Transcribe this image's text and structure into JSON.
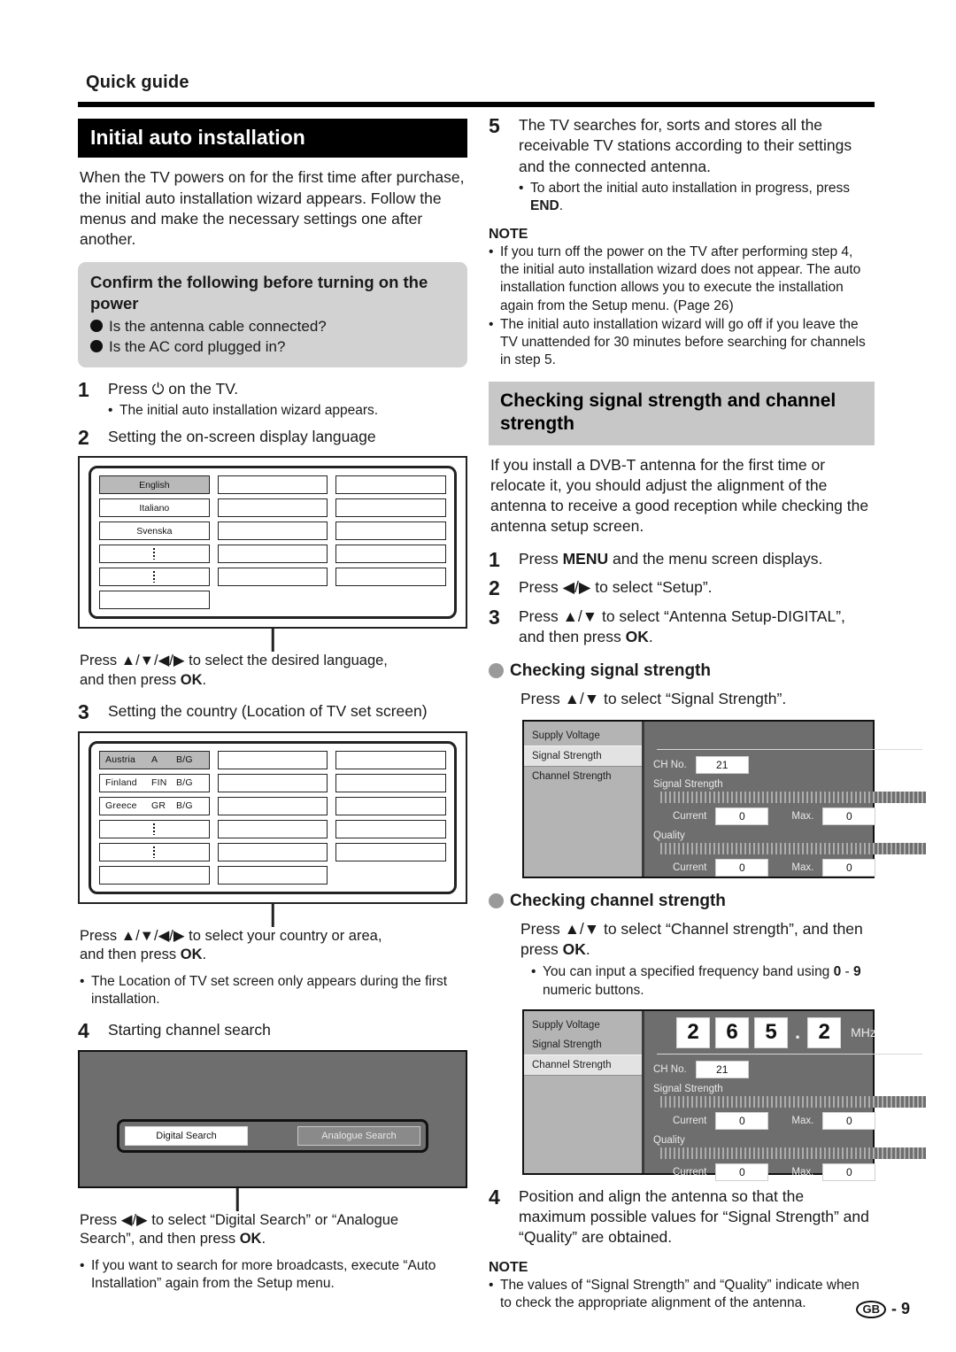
{
  "header": {
    "kicker": "Quick guide"
  },
  "left": {
    "section_title": "Initial auto installation",
    "intro": "When the TV powers on for the first time after purchase, the initial auto installation wizard appears. Follow the menus and make the necessary settings one after another.",
    "callout": {
      "heading": "Confirm the following  before turning on the power",
      "items": [
        "Is the antenna cable connected?",
        "Is the AC cord plugged in?"
      ]
    },
    "steps": [
      {
        "num": "1",
        "text": "Press ⏻ on the TV.",
        "bullets": [
          "The initial auto installation wizard appears."
        ]
      },
      {
        "num": "2",
        "text": "Setting the on-screen display language",
        "bullets": []
      },
      {
        "num": "3",
        "text": "Setting the country (Location of TV set screen)",
        "bullets": []
      },
      {
        "num": "4",
        "text": "Starting channel search",
        "bullets": []
      }
    ],
    "language_screen": {
      "col1": [
        "English",
        "Italiano",
        "Svenska",
        "",
        "",
        ""
      ],
      "col2": [
        "",
        "",
        "",
        "",
        "",
        ""
      ],
      "col3": [
        "",
        "",
        "",
        "",
        ""
      ],
      "selected": "English"
    },
    "language_caption_1": "Press ▲/▼/◀/▶ to select the desired language,",
    "language_caption_2": "and then press ",
    "language_caption_ok": "OK",
    "language_caption_end": ".",
    "country_screen": {
      "rows": [
        {
          "name": "Austria",
          "code": "A",
          "sys": "B/G",
          "selected": true
        },
        {
          "name": "Finland",
          "code": "FIN",
          "sys": "B/G",
          "selected": false
        },
        {
          "name": "Greece",
          "code": "GR",
          "sys": "B/G",
          "selected": false
        }
      ]
    },
    "country_caption_1": "Press ▲/▼/◀/▶ to select your country or area,",
    "country_caption_2": "and then press ",
    "country_caption_ok": "OK",
    "country_caption_end": ".",
    "country_bullet": "The Location of TV set screen only appears during the first installation.",
    "search_screen": {
      "digital_label": "Digital Search",
      "analogue_label": "Analogue Search"
    },
    "search_caption_1": "Press ◀/▶ to select “Digital Search” or “Analogue",
    "search_caption_2": "Search”, and then press ",
    "search_caption_ok": "OK",
    "search_caption_end": ".",
    "search_bullet": "If you want to search for more broadcasts, execute “Auto Installation” again from the Setup menu."
  },
  "right": {
    "step5": {
      "num": "5",
      "text": "The TV searches for, sorts and stores all the receivable TV stations according to their settings and the connected antenna.",
      "bullet_pre": "To abort the initial auto installation in progress, press ",
      "bullet_bold": "END",
      "bullet_post": "."
    },
    "note1_heading": "NOTE",
    "note1_items": [
      "If you turn off the power on the TV after performing step 4, the initial auto installation wizard does not appear. The auto installation function allows you to execute the installation again from the Setup menu. (Page 26)",
      "The initial auto installation wizard will go off if you leave the TV unattended for 30 minutes before searching for channels in step 5."
    ],
    "section_title": "Checking signal strength and channel strength",
    "intro": "If you install a DVB-T antenna for the first time or relocate it, you should adjust the alignment of the antenna to receive a good reception while checking the antenna setup screen.",
    "steps": [
      {
        "num": "1",
        "pre": "Press ",
        "bold": "MENU",
        "post": " and the menu screen displays."
      },
      {
        "num": "2",
        "pre": "Press ◀/▶ to select “Setup”.",
        "bold": "",
        "post": ""
      },
      {
        "num": "3",
        "pre": "Press ▲/▼ to select “Antenna Setup-DIGITAL”, and then press ",
        "bold": "OK",
        "post": "."
      }
    ],
    "signal_subhead": "Checking signal strength",
    "signal_instruction": "Press ▲/▼ to select “Signal Strength”.",
    "channel_subhead": "Checking channel strength",
    "channel_instruction_pre": "Press ▲/▼ to select “Channel strength”, and then press ",
    "channel_instruction_bold": "OK",
    "channel_instruction_post": ".",
    "channel_bullet_pre": "You can input a specified frequency band using ",
    "channel_bullet_bold1": "0",
    "channel_bullet_mid": " - ",
    "channel_bullet_bold2": "9",
    "channel_bullet_post": " numeric buttons.",
    "step4": {
      "num": "4",
      "text": "Position and align the antenna so that the maximum possible values for “Signal Strength” and “Quality” are obtained."
    },
    "note2_heading": "NOTE",
    "note2_items": [
      "The values of “Signal Strength” and “Quality” indicate when to check the appropriate alignment of the antenna."
    ],
    "osd": {
      "menu_items": [
        "Supply Voltage",
        "Signal Strength",
        "Channel Strength"
      ],
      "signal_active": "Signal Strength",
      "channel_active": "Channel Strength",
      "ch_no_label": "CH No.",
      "ch_no_value": "21",
      "signal_strength_label": "Signal Strength",
      "quality_label": "Quality",
      "current_label": "Current",
      "max_label": "Max.",
      "current_value": "0",
      "max_value": "0",
      "frequency_digits": [
        "2",
        "6",
        "5",
        "2"
      ],
      "frequency_separator": ".",
      "frequency_unit": "MHz"
    }
  },
  "footer": {
    "region": "GB",
    "page": "- 9"
  }
}
